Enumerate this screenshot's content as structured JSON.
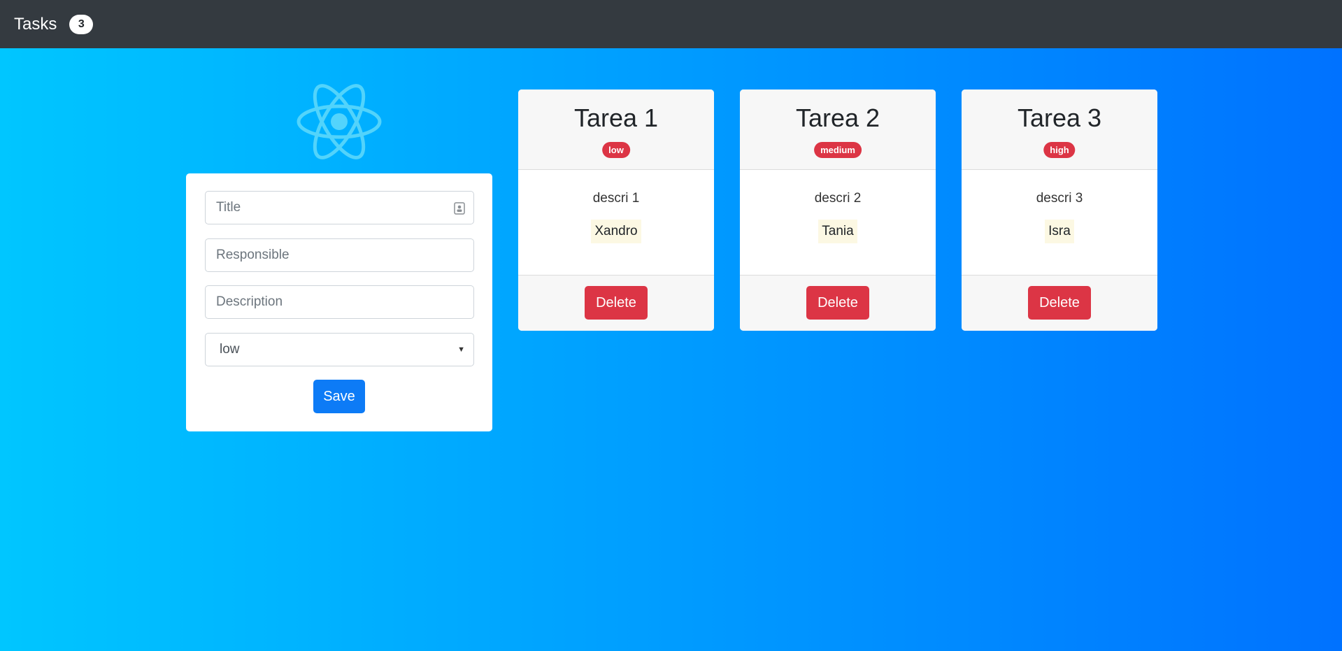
{
  "navbar": {
    "title": "Tasks",
    "count": "3"
  },
  "form": {
    "title_placeholder": "Title",
    "responsible_placeholder": "Responsible",
    "description_placeholder": "Description",
    "priority_selected": "low",
    "save_label": "Save"
  },
  "tasks": [
    {
      "title": "Tarea 1",
      "priority": "low",
      "description": "descri 1",
      "responsible": "Xandro",
      "delete_label": "Delete"
    },
    {
      "title": "Tarea 2",
      "priority": "medium",
      "description": "descri 2",
      "responsible": "Tania",
      "delete_label": "Delete"
    },
    {
      "title": "Tarea 3",
      "priority": "high",
      "description": "descri 3",
      "responsible": "Isra",
      "delete_label": "Delete"
    }
  ],
  "colors": {
    "gradient_start": "#00c6ff",
    "gradient_end": "#0072ff",
    "navbar": "#343a40",
    "primary": "#0d7bf6",
    "danger": "#dc3545",
    "highlight": "#fcf8e3"
  },
  "icons": {
    "logo": "react-atom-logo",
    "title_field": "contact-card-icon",
    "select": "caret-down-icon"
  }
}
